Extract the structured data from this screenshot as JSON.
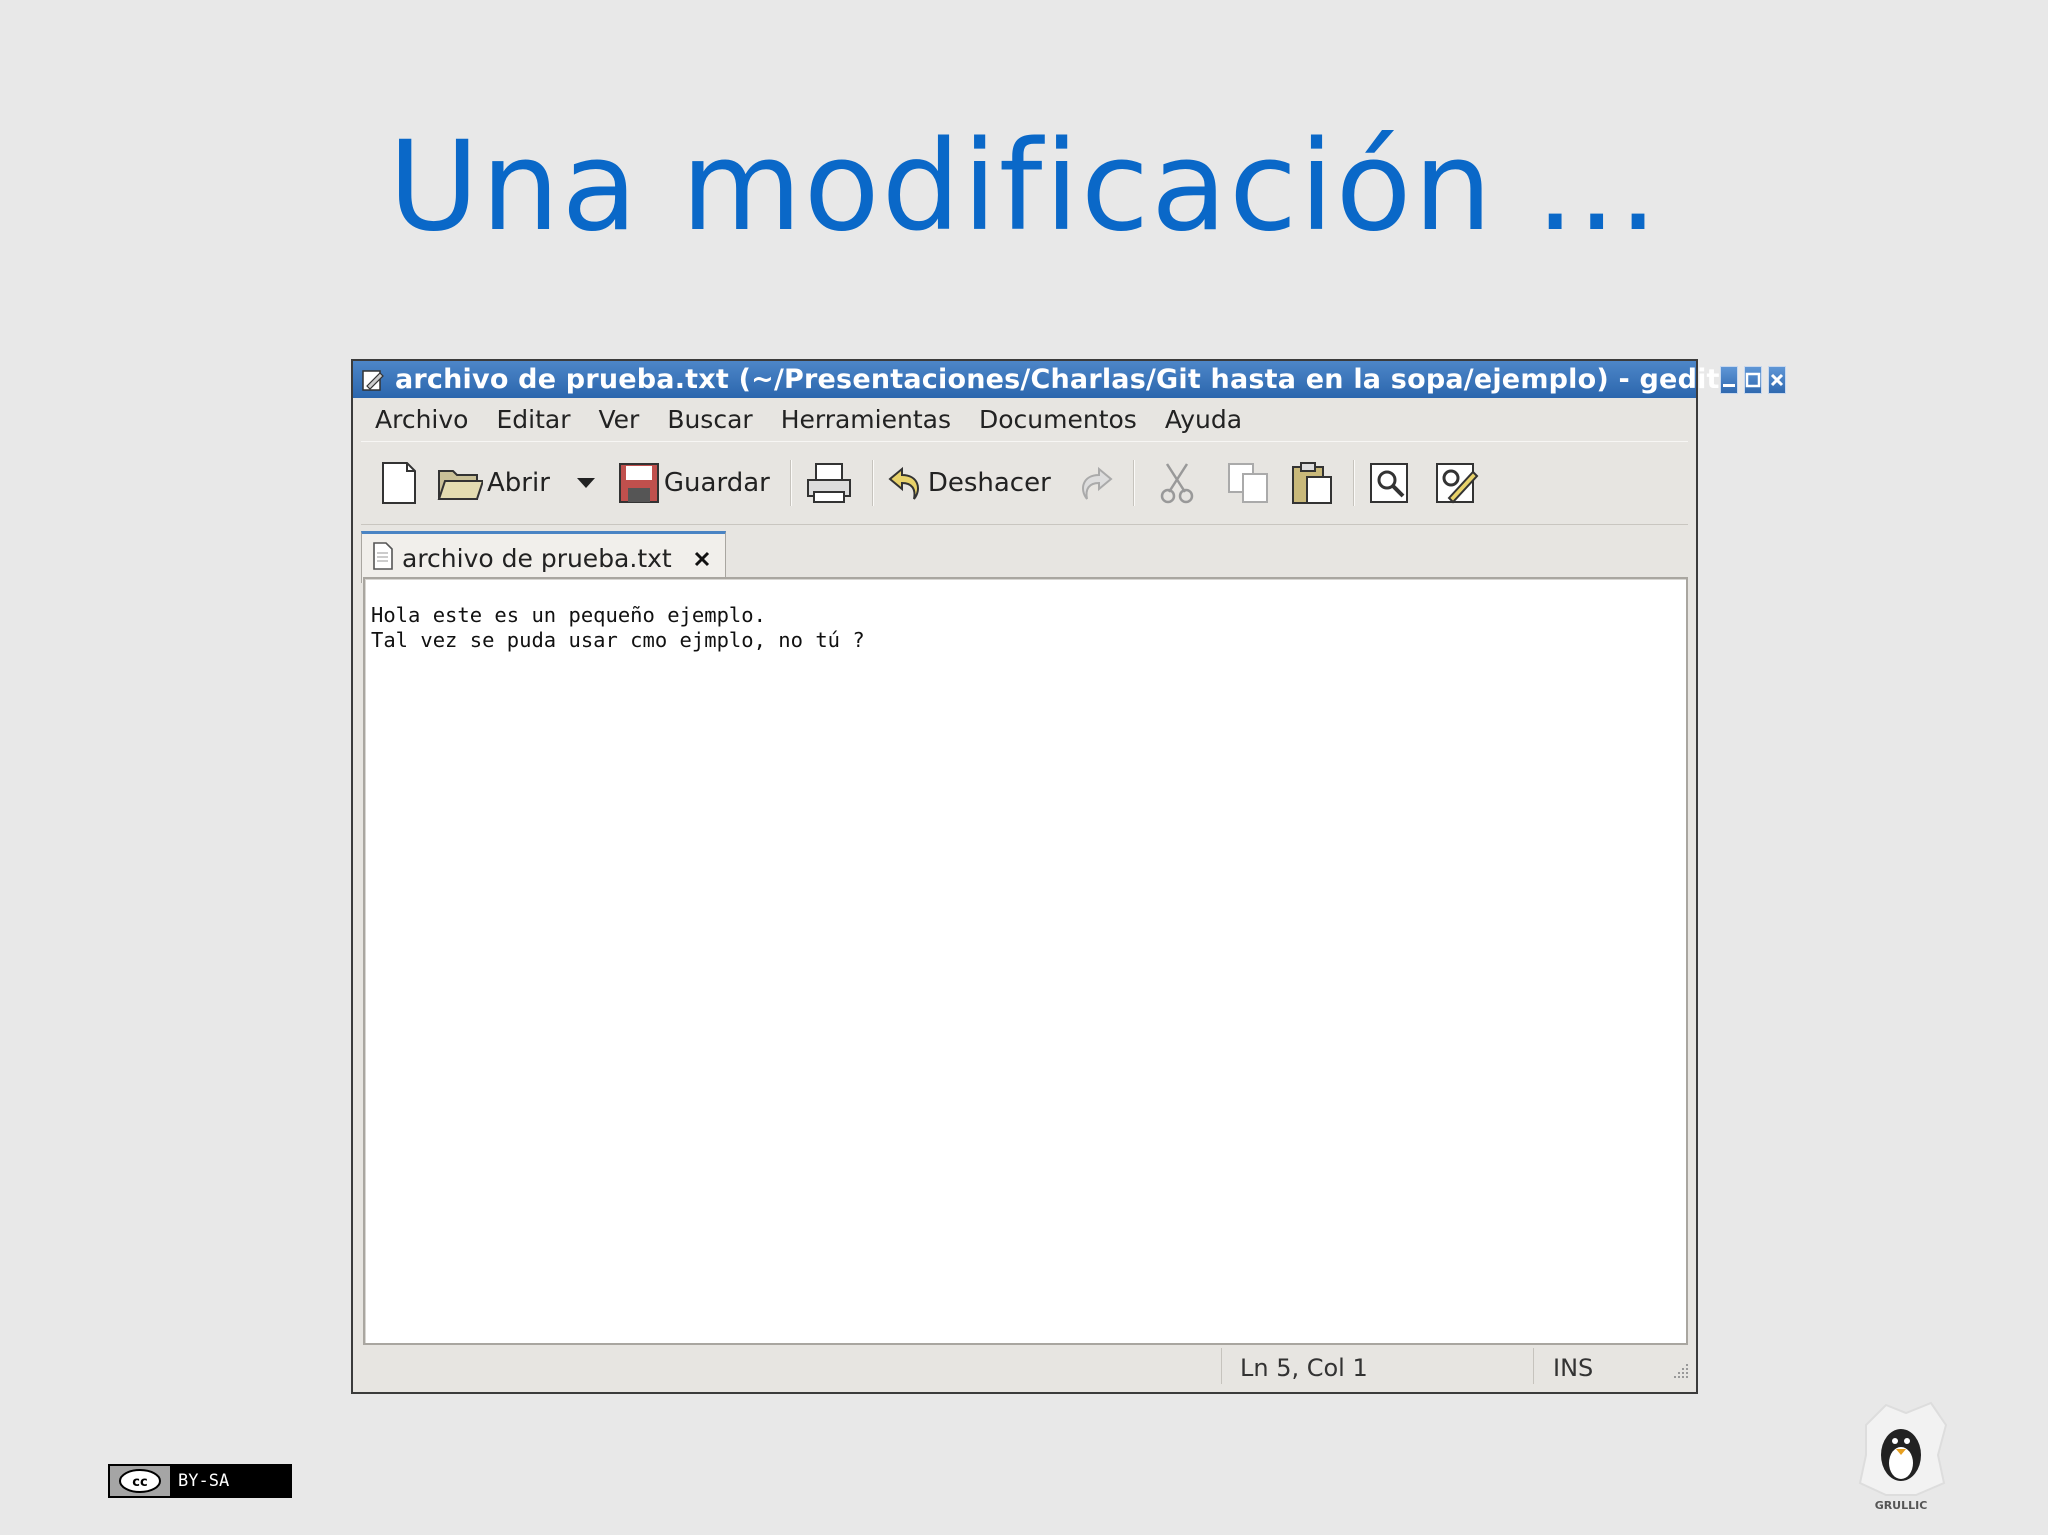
{
  "slide": {
    "title": "Una modificación ..."
  },
  "window": {
    "title": "archivo de prueba.txt (~/Presentaciones/Charlas/Git hasta en la sopa/ejemplo) - gedit",
    "controls": {
      "minimize": "–",
      "maximize": "□",
      "close": "×"
    }
  },
  "menu": {
    "items": [
      "Archivo",
      "Editar",
      "Ver",
      "Buscar",
      "Herramientas",
      "Documentos",
      "Ayuda"
    ]
  },
  "toolbar": {
    "open_label": "Abrir",
    "save_label": "Guardar",
    "undo_label": "Deshacer"
  },
  "tab": {
    "label": "archivo de prueba.txt",
    "close": "×"
  },
  "editor": {
    "content": "Hola este es un pequeño ejemplo.\nTal vez se puda usar cmo ejmplo, no tú ?"
  },
  "statusbar": {
    "position": "Ln 5, Col 1",
    "mode": "INS"
  },
  "footer": {
    "license": "BY-SA",
    "license_mark": "cc",
    "logo_text": "GRULLIC"
  },
  "colors": {
    "title": "#0a68c8",
    "titlebar": "#2b66ad",
    "background": "#e8e8e8"
  }
}
